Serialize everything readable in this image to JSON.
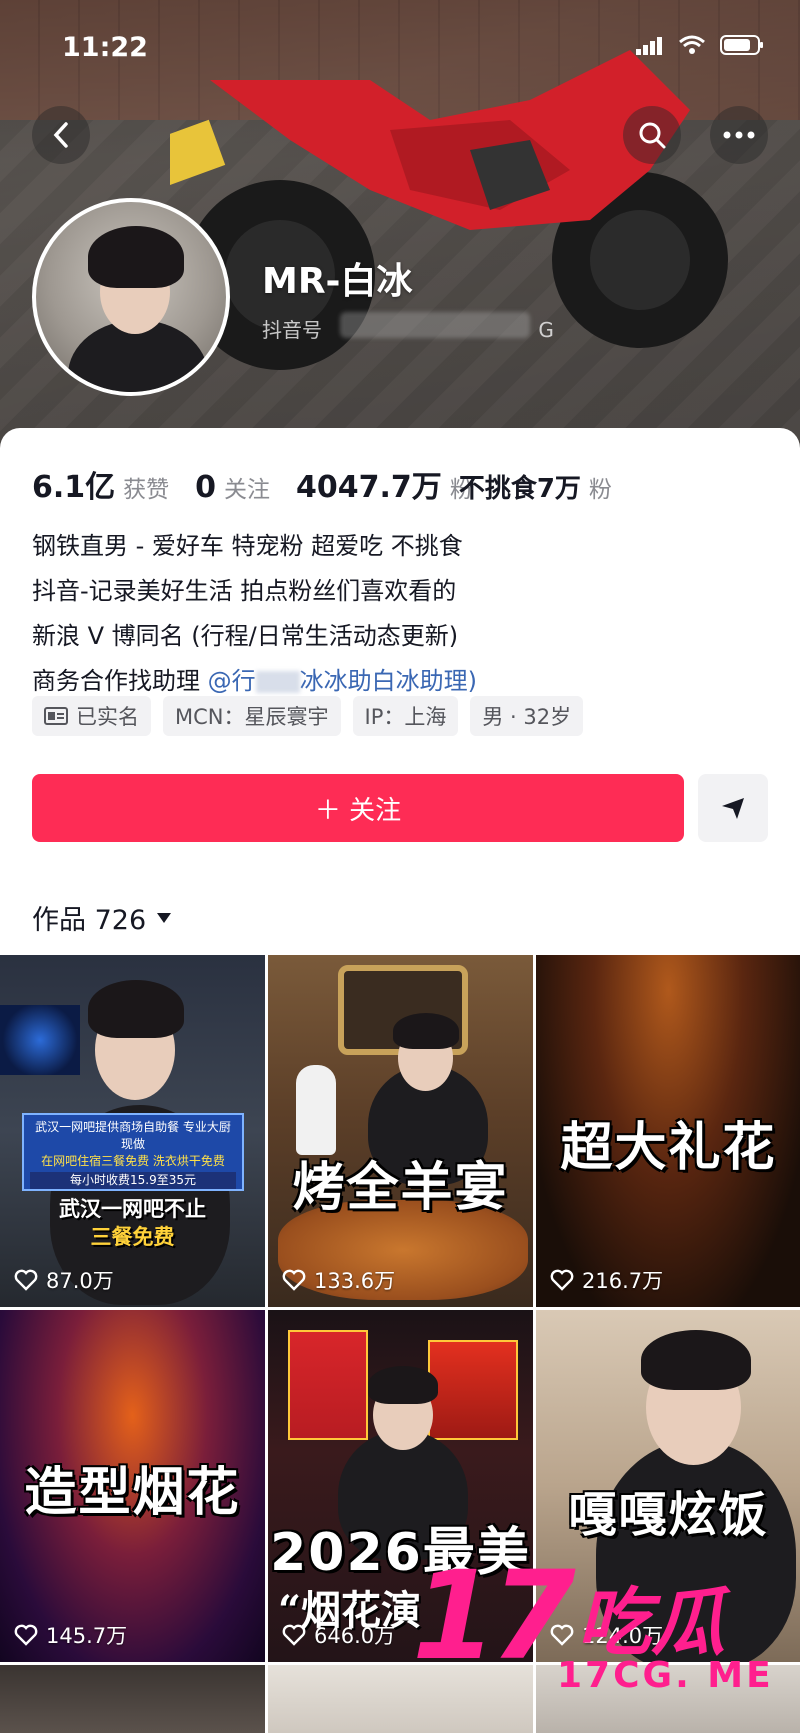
{
  "status_bar": {
    "time": "11:22"
  },
  "profile": {
    "nickname": "MR-白冰",
    "douyin_id_label": "抖音号",
    "douyin_id_partial": "G"
  },
  "stats": [
    {
      "value": "6.1亿",
      "label": "获赞"
    },
    {
      "value": "0",
      "label": "关注"
    },
    {
      "value": "4047.7万",
      "label": "粉"
    },
    {
      "value": "不挑食7万",
      "label": "粉"
    }
  ],
  "bio": {
    "lines": [
      "钢铁直男 - 爱好车 特宠粉 超爱吃 不挑食",
      "抖音-记录美好生活 拍点粉丝们喜欢看的",
      "新浪 V 博同名 (行程/日常生活动态更新)"
    ],
    "line4_prefix": "商务合作找助理 ",
    "line4_mention_start": "@行",
    "line4_mention_end": "冰冰助白冰助理)"
  },
  "tags": [
    {
      "icon": "id-card-icon",
      "label": "已实名"
    },
    {
      "icon": "",
      "label": "MCN：星辰寰宇"
    },
    {
      "icon": "",
      "label": "IP：上海"
    },
    {
      "icon": "",
      "label": "男 · 32岁"
    }
  ],
  "actions": {
    "follow_label": "＋ 关注"
  },
  "works": {
    "label": "作品 726"
  },
  "videos": [
    {
      "caption": "",
      "overlay_lines": [
        "武汉一网吧提供商场自助餐 专业大厨现做",
        "在网吧住宿三餐免费 洗衣烘干免费",
        "每小时收费15.9至35元",
        "武汉一网吧不止",
        "三餐免费"
      ],
      "likes": "87.0万"
    },
    {
      "caption": "烤全羊宴",
      "overlay_lines": [],
      "likes": "133.6万"
    },
    {
      "caption": "超大礼花",
      "overlay_lines": [],
      "likes": "216.7万"
    },
    {
      "caption": "造型烟花",
      "overlay_lines": [],
      "likes": "145.7万"
    },
    {
      "caption": "2026最美",
      "overlay_lines": [
        "“烟花演"
      ],
      "likes": "646.0万"
    },
    {
      "caption": "嘎嘎炫饭",
      "overlay_lines": [],
      "likes": "124.0万"
    }
  ],
  "watermark": {
    "big": "17",
    "cn": "吃瓜",
    "url": "17CG. ME"
  },
  "colors": {
    "accent": "#fe2c55",
    "mention": "#3a67b3",
    "watermark": "#ff1f8e"
  }
}
